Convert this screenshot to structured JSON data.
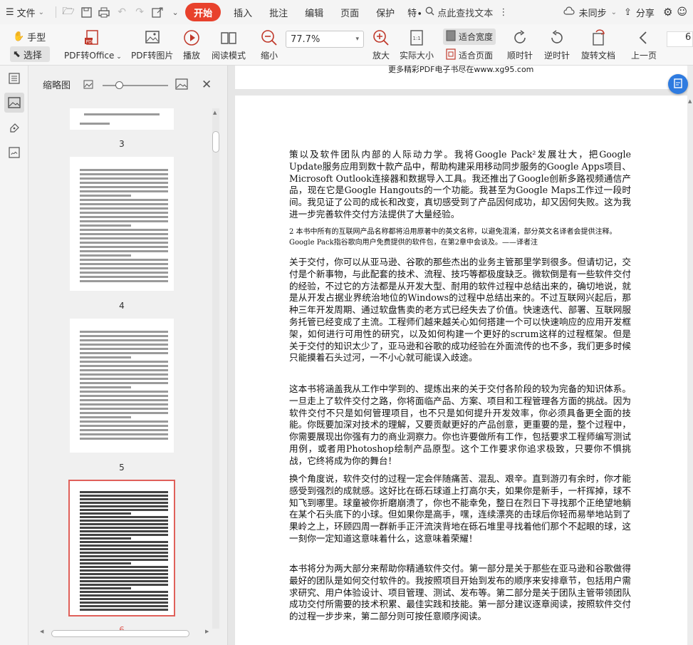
{
  "menubar": {
    "file": "文件",
    "tabs": [
      {
        "label": "开始"
      },
      {
        "label": "插入"
      },
      {
        "label": "批注"
      },
      {
        "label": "编辑"
      },
      {
        "label": "页面"
      },
      {
        "label": "保护"
      },
      {
        "label": "特∙"
      }
    ],
    "search": "点此查找文本",
    "sync": "未同步",
    "share": "分享"
  },
  "toolbar": {
    "hand": "手型",
    "select": "选择",
    "pdf_to_office": "PDF转Office",
    "pdf_to_image": "PDF转图片",
    "play": "播放",
    "read_mode": "阅读模式",
    "zoom_out": "缩小",
    "zoom_value": "77.7%",
    "zoom_in": "放大",
    "actual_size": "实际大小",
    "fit_width": "适合宽度",
    "fit_page": "适合页面",
    "rotate_cw": "顺时针",
    "rotate_ccw": "逆时针",
    "rotate_doc": "旋转文档",
    "prev_page": "上一页",
    "page_number": "6"
  },
  "thumbnails": {
    "title": "缩略图",
    "pages": [
      "3",
      "4",
      "5",
      "6"
    ],
    "current": "6"
  },
  "document": {
    "prev_footer": "更多精彩PDF电子书尽在www.xg95.com",
    "paragraphs": [
      "策以及软件团队内部的人际动力学。我将Google Pack²发展壮大，把Google Update服务应用到数十款产品中，帮助构建采用移动同步服务的Google Apps项目、Microsoft Outlook连接器和数据导入工具。我还推出了Google创新多路视频通信产品，现在它是Google Hangouts的一个功能。我甚至为Google Maps工作过一段时间。我见证了公司的成长和改变，真切感受到了产品因何成功，却又因何失败。这为我进一步完善软件交付方法提供了大量经验。",
      "关于交付，你可以从亚马逊、谷歌的那些杰出的业务主管那里学到很多。但请切记，交付是个新事物，与此配套的技术、流程、技巧等都极度缺乏。微软倒是有一些软件交付的经验，不过它的方法都是从开发大型、耐用的软件过程中总结出来的，确切地说，就是从开发占据业界统治地位的Windows的过程中总结出来的。不过互联网兴起后，那种三年开发周期、通过软盘售卖的老方式已经失去了价值。快速迭代、部署、互联网服务托管已经变成了主流。工程师们越来越关心如何搭建一个可以快速响应的应用开发框架，如何进行可用性的研究，以及如何构建一个更好的scrum这样的过程框架。但是关于交付的知识太少了，亚马逊和谷歌的成功经验在外面流传的也不多，我们更多时候只能摸着石头过河，一不小心就可能误入歧途。",
      "这本书将涵盖我从工作中学到的、提炼出来的关于交付各阶段的较为完备的知识体系。一旦走上了软件交付之路，你将面临产品、方案、项目和工程管理各方面的挑战。因为软件交付不只是如何管理项目，也不只是如何提升开发效率，你必须具备更全面的技能。你既要加深对技术的理解，又要贡献更好的产品创意，更重要的是，整个过程中，你需要展现出你强有力的商业洞察力。你也许要做所有工作，包括要求工程师编写测试用例，或者用Photoshop绘制产品原型。这个工作要求你追求极致，只要你不惧挑战，它终将成为你的舞台！",
      "换个角度说，软件交付的过程一定会伴随痛苦、混乱、艰辛。直到游刃有余时，你才能感受到强烈的成就感。这好比在砾石球道上打高尔夫，如果你是新手，一杆挥掉，球不知飞到哪里。球童被你折磨崩溃了，你也不能幸免，整日在烈日下寻找那个正绝望地躺在某个石头底下的小球。但如果你是高手，嘿，连续漂亮的击球后你轻而易举地站到了果岭之上，环顾四周一群新手正汗流浃背地在砾石堆里寻找着他们那个不起眼的球，这一刻你一定知道这意味着什么，这意味着荣耀！",
      "本书将分为两大部分来帮助你精通软件交付。第一部分是关于那些在亚马逊和谷歌做得最好的团队是如何交付软件的。我按照项目开始到发布的顺序来安排章节，包括用户需求研究、用户体验设计、项目管理、测试、发布等。第二部分是关于团队主管带领团队成功交付所需要的技术积累、最佳实践和技能。第一部分建议逐章阅读，按照软件交付的过程一步步来，第二部分则可按任意顺序阅读。"
    ],
    "footnote": "2 本书中所有的互联网产品名称都将沿用原著中的英文名称，以避免混淆，部分英文名译者会提供注释。Google Pack指谷歌向用户免费提供的软件包，在第2章中会谈及。——译者注"
  }
}
